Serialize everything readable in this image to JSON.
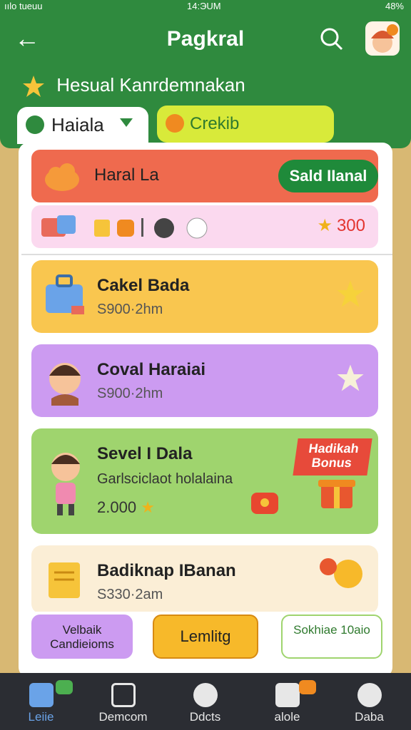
{
  "status": {
    "left": "ıılo tueuu",
    "time": "14:ЭUM",
    "right": "48%"
  },
  "header": {
    "title": "Pagkral",
    "subtitle": "Hesual Kanrdemnakan"
  },
  "tabs": [
    {
      "label": "Haiala"
    },
    {
      "label": "Crekib"
    }
  ],
  "promo": {
    "label": "Haral La",
    "button": "Sald IIanal"
  },
  "items": {
    "score": "300"
  },
  "cards": [
    {
      "title": "Cakel Bada",
      "subtitle": "S900·2hm"
    },
    {
      "title": "Coval Haraiai",
      "subtitle": "S900·2hm"
    },
    {
      "title": "Sevel I Dala",
      "subtitle": "Garlsciclaot holalaina",
      "points": "2.000",
      "bonus": "Hadikah Bonus"
    },
    {
      "title": "Badiknap IBanan",
      "subtitle": "S330·2am"
    }
  ],
  "actions": {
    "left": "Velbaik Candieioms",
    "middle": "Lemlitg",
    "right": "Sokhiae 10aio"
  },
  "nav": [
    {
      "label": "Leiie"
    },
    {
      "label": "Demcom"
    },
    {
      "label": "Ddcts"
    },
    {
      "label": "alole"
    },
    {
      "label": "Daba"
    }
  ],
  "colors": {
    "header": "#2f8a3e",
    "promo": "#ef6a4e",
    "card1": "#f9c64f",
    "card2": "#cc9bf1",
    "card3": "#9fd46e",
    "card4": "#fbeed6"
  }
}
